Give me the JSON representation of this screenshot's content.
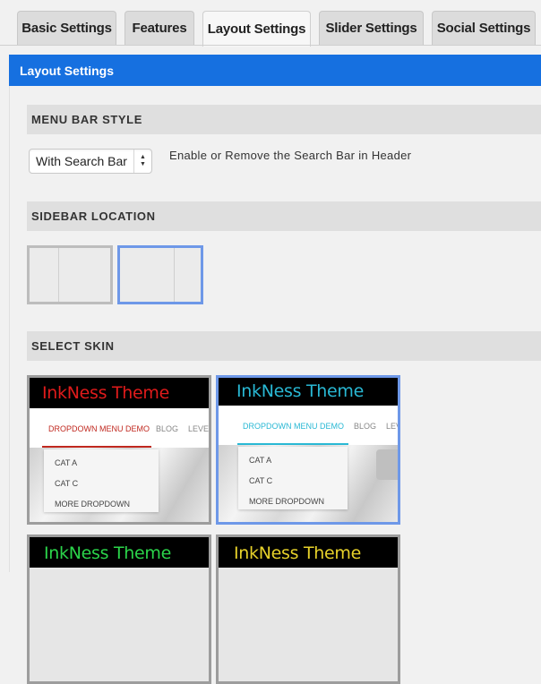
{
  "tabs": [
    {
      "label": "Basic Settings"
    },
    {
      "label": "Features"
    },
    {
      "label": "Layout Settings"
    },
    {
      "label": "Slider Settings"
    },
    {
      "label": "Social Settings"
    }
  ],
  "section": {
    "title": "Layout Settings"
  },
  "menu_bar": {
    "title": "MENU BAR STYLE",
    "select_value": "With Search Bar",
    "description": "Enable or Remove the Search Bar in Header"
  },
  "sidebar": {
    "title": "SIDEBAR LOCATION"
  },
  "skins": {
    "title": "SELECT SKIN",
    "items": [
      {
        "title": "InkNess Theme",
        "color": "#e01b1b",
        "menu": [
          "DROPDOWN MENU DEMO",
          "BLOG",
          "LEVE"
        ],
        "dropdown": [
          "CAT A",
          "CAT C",
          "MORE DROPDOWN"
        ]
      },
      {
        "title": "InkNess Theme",
        "color": "#29b8d4",
        "menu": [
          "DROPDOWN MENU DEMO",
          "BLOG",
          "LEV"
        ],
        "dropdown": [
          "CAT A",
          "CAT C",
          "MORE DROPDOWN"
        ]
      },
      {
        "title": "InkNess Theme",
        "color": "#2bd44a"
      },
      {
        "title": "InkNess Theme",
        "color": "#e6d12a"
      }
    ]
  }
}
